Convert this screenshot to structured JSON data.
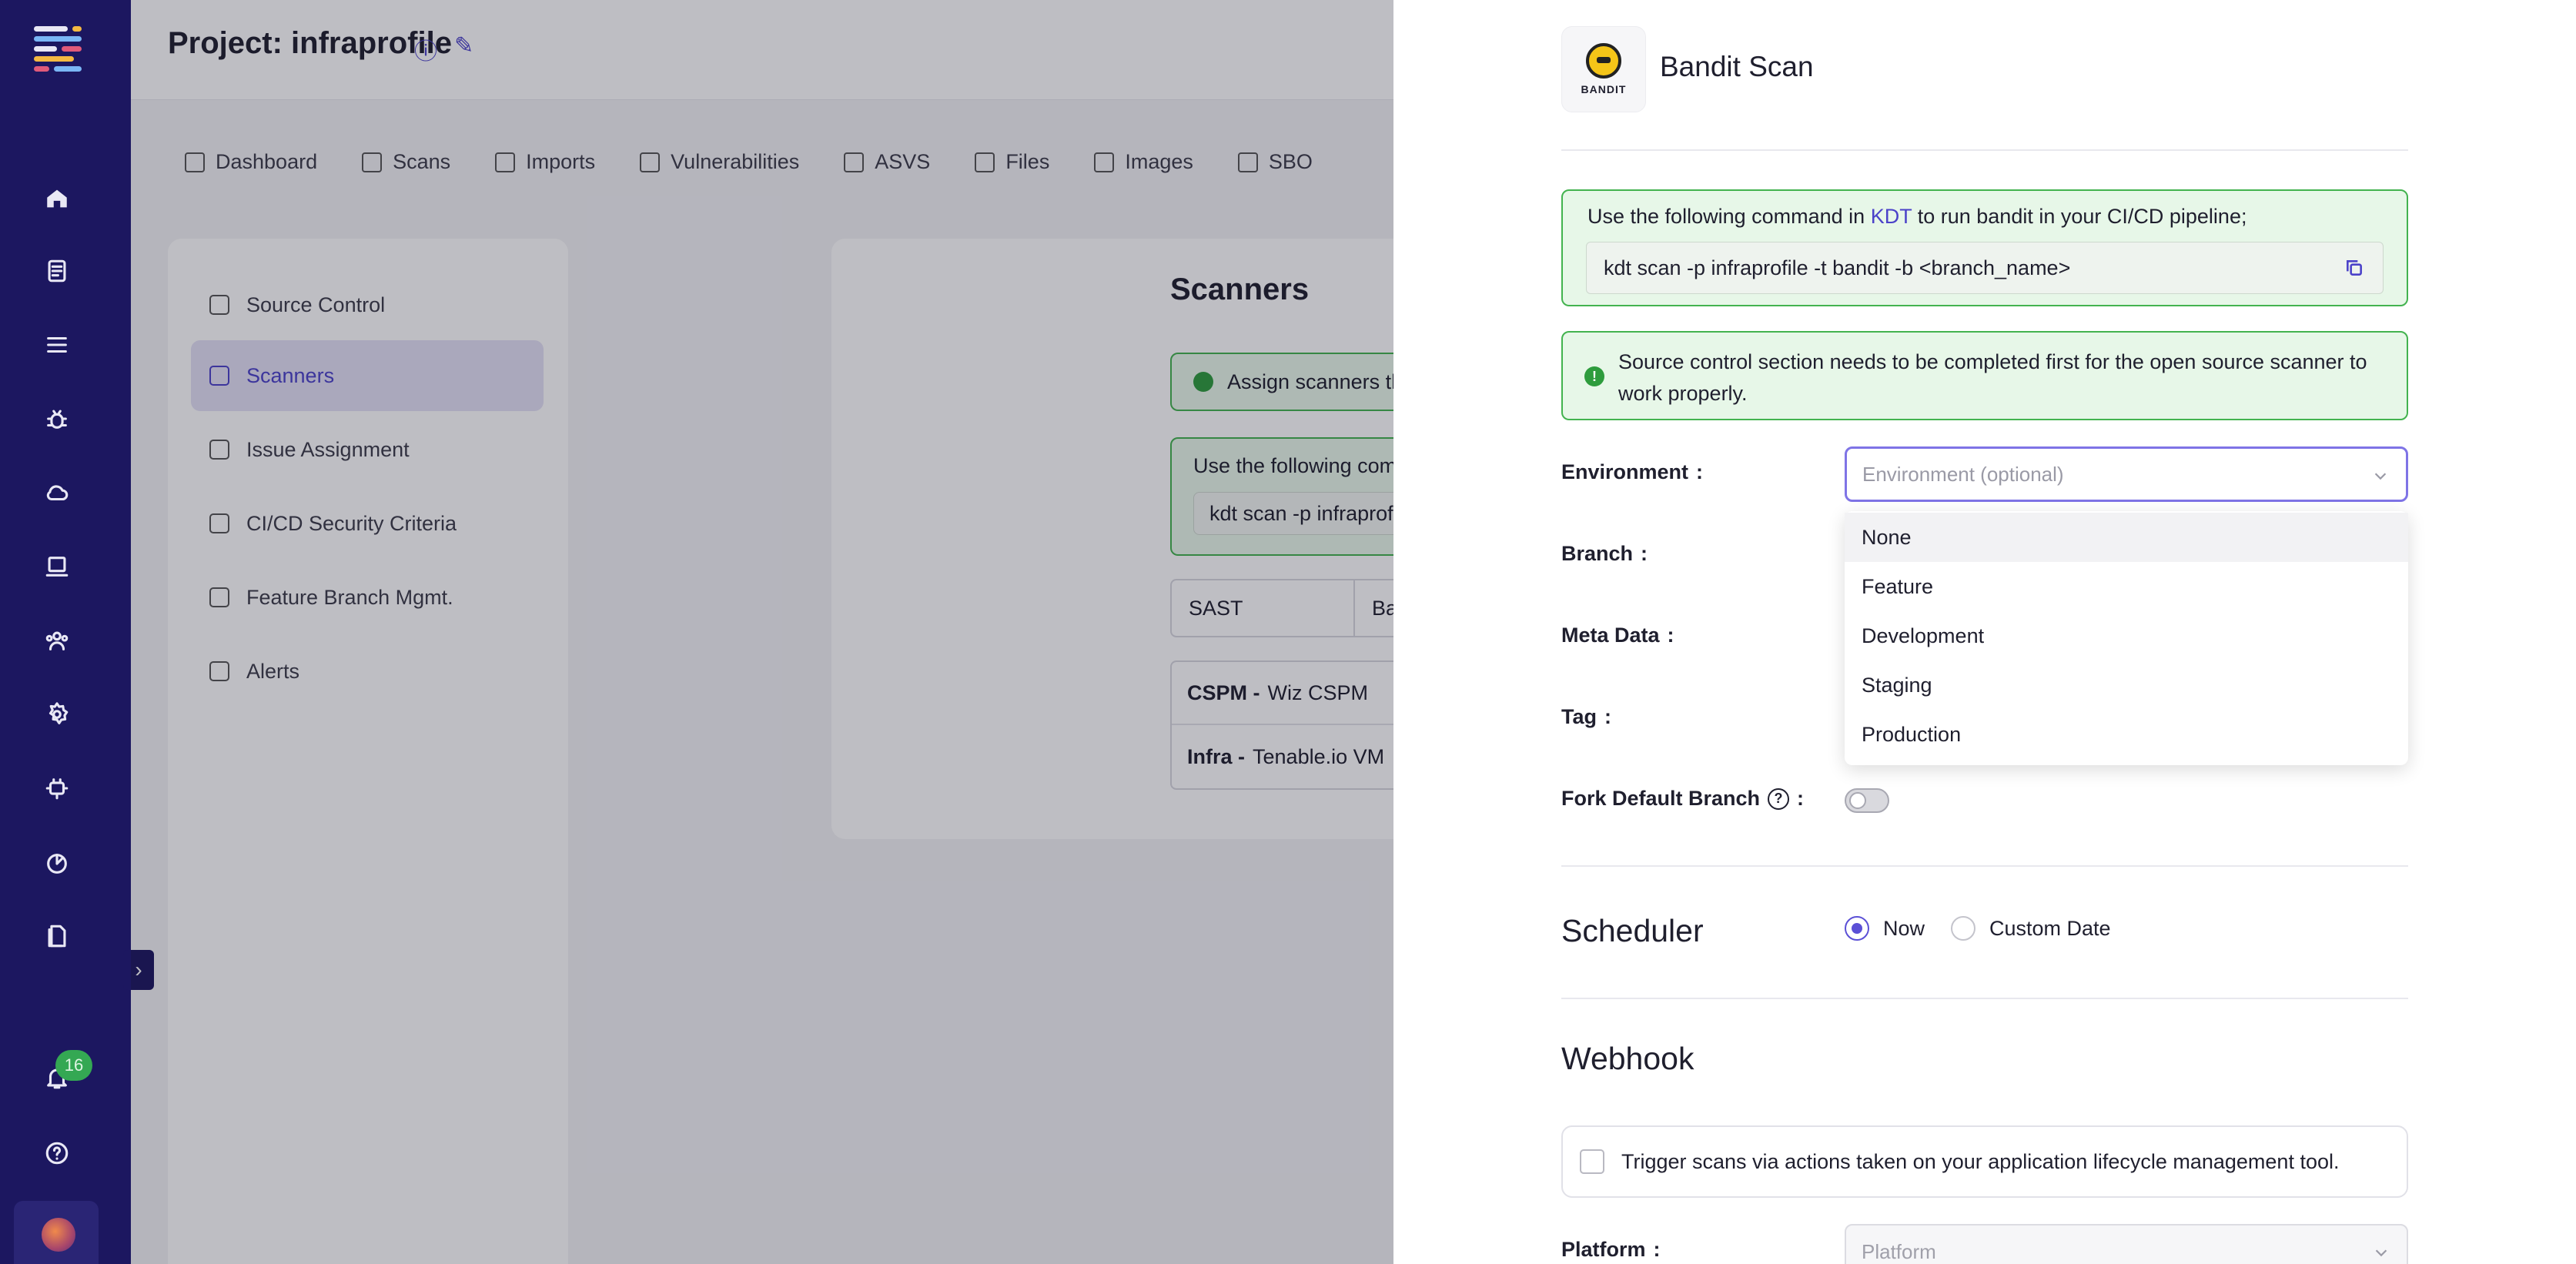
{
  "app": {
    "project_title": "Project: infraprofile",
    "notification_count": "16"
  },
  "rail_icons": [
    "home-icon",
    "reports-icon",
    "list-icon",
    "bug-icon",
    "cloud-icon",
    "laptop-icon",
    "team-icon",
    "settings-icon",
    "plugin-icon",
    "integrations-icon",
    "docs-icon",
    "bell-icon",
    "help-icon"
  ],
  "tabs": [
    "Dashboard",
    "Scans",
    "Imports",
    "Vulnerabilities",
    "ASVS",
    "Files",
    "Images",
    "SBO"
  ],
  "settings_menu": [
    "Source Control",
    "Scanners",
    "Issue Assignment",
    "CI/CD Security Criteria",
    "Feature Branch Mgmt.",
    "Alerts"
  ],
  "content": {
    "heading": "Scanners",
    "alert": "Assign scanners th",
    "cmd_intro": "Use the following com",
    "cmd_value": "kdt scan -p infraprof",
    "filter_type": "SAST",
    "filter_other": "Ba",
    "rows": [
      {
        "prefix": "CSPM -",
        "name": "Wiz CSPM"
      },
      {
        "prefix": "Infra -",
        "name": "Tenable.io VM"
      }
    ]
  },
  "drawer": {
    "logo_text": "BANDIT",
    "title": "Bandit Scan",
    "cmd_prefix": "Use the following command in",
    "cmd_link": "KDT",
    "cmd_suffix": "to run bandit in your CI/CD pipeline;",
    "cmd_value": "kdt scan -p infraprofile  -t bandit -b <branch_name>",
    "info_text": "Source control section needs to be completed first for the open source scanner to work properly.",
    "labels": {
      "environment": "Environment",
      "branch": "Branch",
      "meta_data": "Meta Data",
      "tag": "Tag",
      "fork_default_branch": "Fork Default Branch",
      "platform": "Platform"
    },
    "environment_placeholder": "Environment (optional)",
    "environment_options": [
      "None",
      "Feature",
      "Development",
      "Staging",
      "Production"
    ],
    "scheduler": {
      "title": "Scheduler",
      "now": "Now",
      "custom_date": "Custom Date",
      "selected": "Now"
    },
    "webhook": {
      "title": "Webhook",
      "checkbox_label": "Trigger scans via actions taken on your application lifecycle management tool."
    },
    "platform_placeholder": "Platform"
  },
  "colors": {
    "rail": "#1c1760",
    "accent": "#4b42c9",
    "success_bg": "#e7f7e8",
    "success_border": "#43b34f"
  }
}
